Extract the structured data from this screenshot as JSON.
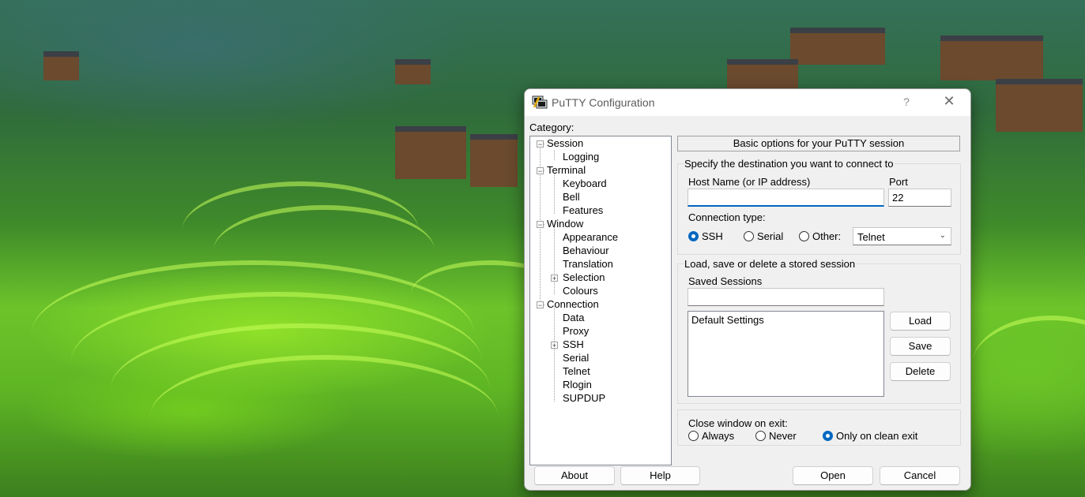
{
  "window": {
    "title": "PuTTY Configuration",
    "help_glyph": "?",
    "close_glyph": "✕",
    "app_icon": "putty-icon"
  },
  "category": {
    "label": "Category:",
    "items": [
      {
        "label": "Session",
        "level": 0
      },
      {
        "label": "Logging",
        "level": 1
      },
      {
        "label": "Terminal",
        "level": 0
      },
      {
        "label": "Keyboard",
        "level": 1
      },
      {
        "label": "Bell",
        "level": 1
      },
      {
        "label": "Features",
        "level": 1
      },
      {
        "label": "Window",
        "level": 0
      },
      {
        "label": "Appearance",
        "level": 1
      },
      {
        "label": "Behaviour",
        "level": 1
      },
      {
        "label": "Translation",
        "level": 1
      },
      {
        "label": "Selection",
        "level": 1
      },
      {
        "label": "Colours",
        "level": 1
      },
      {
        "label": "Connection",
        "level": 0
      },
      {
        "label": "Data",
        "level": 1
      },
      {
        "label": "Proxy",
        "level": 1
      },
      {
        "label": "SSH",
        "level": 1
      },
      {
        "label": "Serial",
        "level": 1
      },
      {
        "label": "Telnet",
        "level": 1
      },
      {
        "label": "Rlogin",
        "level": 1
      },
      {
        "label": "SUPDUP",
        "level": 1
      }
    ]
  },
  "session": {
    "header": "Basic options for your PuTTY session",
    "destination_group": "Specify the destination you want to connect to",
    "host_label": "Host Name (or IP address)",
    "host_value": "",
    "port_label": "Port",
    "port_value": "22",
    "conn_type_label": "Connection type:",
    "conn_types": [
      "SSH",
      "Serial",
      "Other:"
    ],
    "conn_selected": "SSH",
    "other_value": "Telnet",
    "stored_group": "Load, save or delete a stored session",
    "saved_sessions_label": "Saved Sessions",
    "saved_sessions_value": "",
    "sessions_list": [
      "Default Settings"
    ],
    "load_label": "Load",
    "save_label": "Save",
    "delete_label": "Delete",
    "close_group_label": "Close window on exit:",
    "close_options": [
      "Always",
      "Never",
      "Only on clean exit"
    ],
    "close_selected": "Only on clean exit"
  },
  "footer": {
    "about_label": "About",
    "help_label": "Help",
    "open_label": "Open",
    "cancel_label": "Cancel"
  },
  "colors": {
    "accent": "#0067c0",
    "dialog_bg": "#f0f0f0"
  }
}
